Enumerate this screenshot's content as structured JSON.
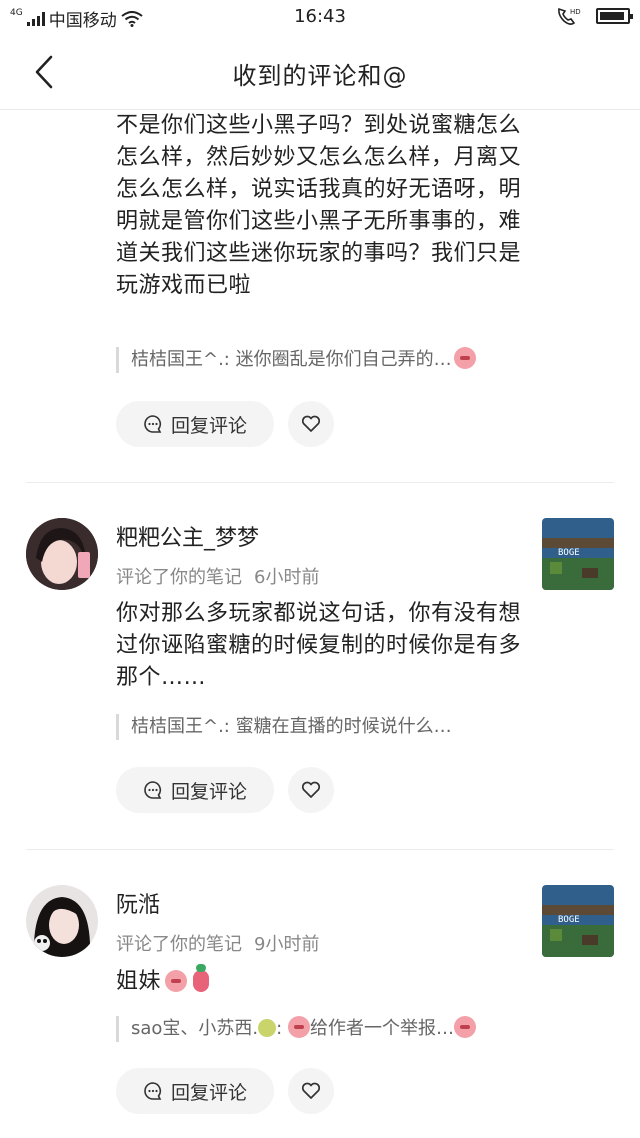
{
  "status_bar": {
    "network_tag": "4G",
    "carrier": "中国移动",
    "time": "16:43",
    "icons": [
      "signal-icon",
      "wifi-icon",
      "hd-call-icon",
      "battery-icon"
    ]
  },
  "nav": {
    "title": "收到的评论和@",
    "back_icon": "back-chevron-icon"
  },
  "comments": [
    {
      "text": "不是你们这些小黑子吗？到处说蜜糖怎么怎么样，然后妙妙又怎么怎么样，月离又怎么怎么样，说实话我真的好无语呀，明明就是管你们这些小黑子无所事事的，难道关我们这些迷你玩家的事吗？我们只是玩游戏而已啦",
      "quote": "桔桔国王^.: 迷你圈乱是你们自己弄的…",
      "reply_label": "回复评论"
    },
    {
      "username": "粑粑公主_梦梦",
      "action": "评论了你的笔记",
      "time": "6小时前",
      "text": "你对那么多玩家都说这句话，你有没有想过你诬陷蜜糖的时候复制的时候你是有多那个……",
      "quote": "桔桔国王^.: 蜜糖在直播的时候说什么…",
      "reply_label": "回复评论",
      "thumb_label": "BOGE"
    },
    {
      "username": "阮湉",
      "action": "评论了你的笔记",
      "time": "9小时前",
      "text": "姐妹",
      "quote_name": "sao宝、小苏西.",
      "quote_text": "给作者一个举报…",
      "reply_label": "回复评论",
      "thumb_label": "BOGE"
    }
  ],
  "colors": {
    "text": "#222222",
    "meta": "#888888",
    "quote_bar": "#d9d9d9",
    "button_bg": "#f4f4f4"
  }
}
